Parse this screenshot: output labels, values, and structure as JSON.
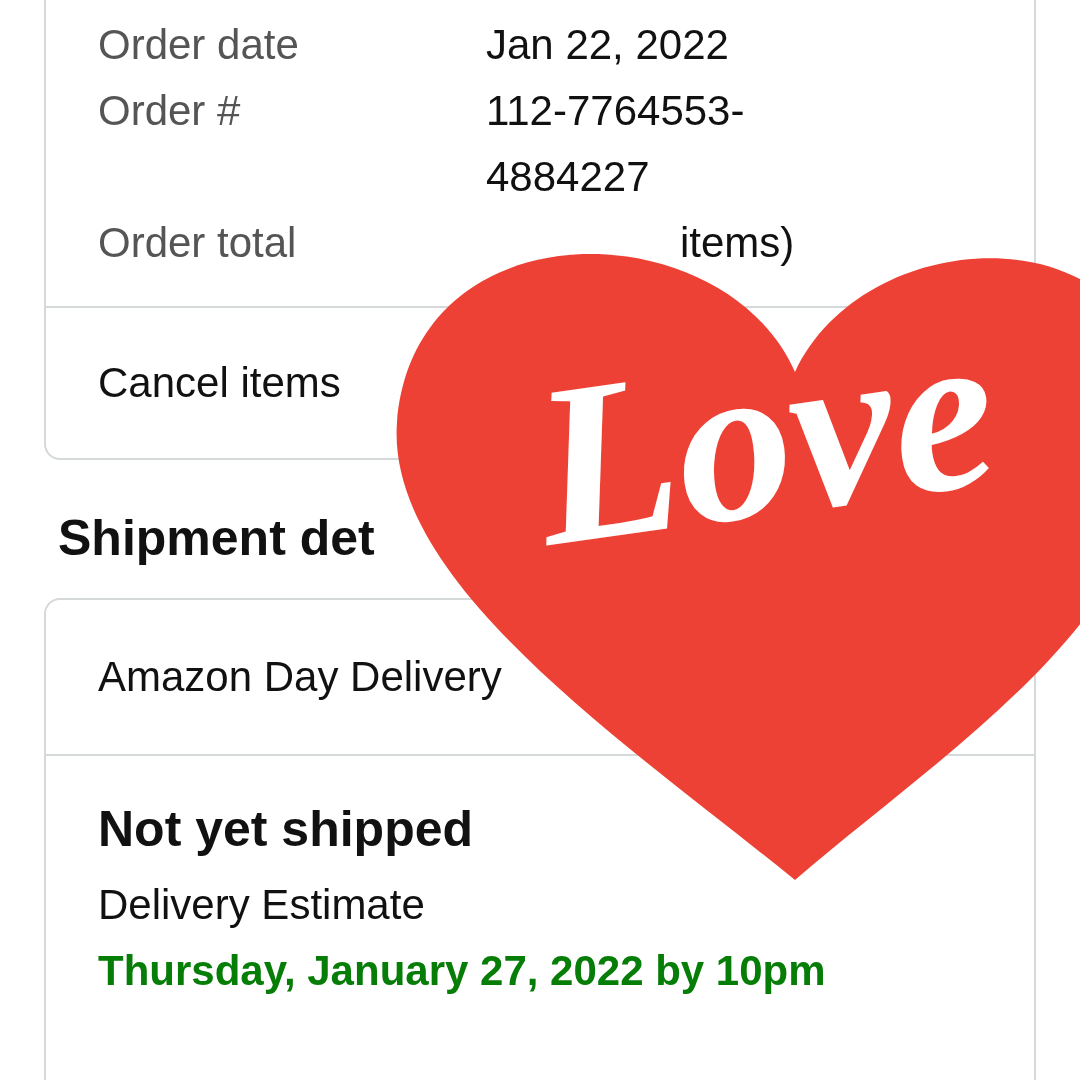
{
  "order_info": [
    {
      "label": "Order date",
      "value": "Jan 22, 2022"
    },
    {
      "label": "Order #",
      "value": "112-7764553-\n4884227"
    },
    {
      "label": "Order total",
      "value": "items)"
    }
  ],
  "cancel_link": "Cancel items",
  "section_title": "Shipment det",
  "shipment": {
    "method": "Amazon Day Delivery",
    "status": "Not yet shipped",
    "estimate_label": "Delivery Estimate",
    "estimate": "Thursday, January 27, 2022 by 10pm"
  },
  "sticker": {
    "text": "Love"
  }
}
